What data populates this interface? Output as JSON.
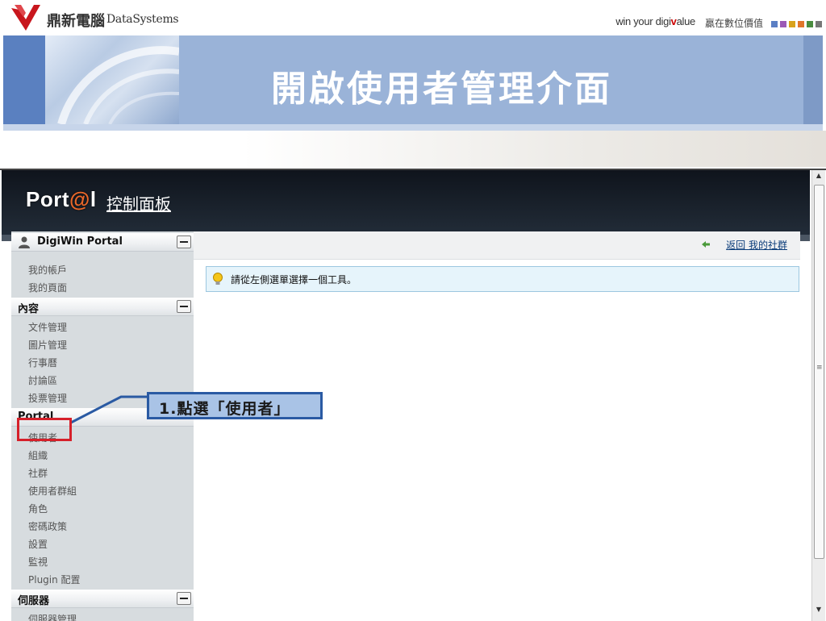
{
  "slide": {
    "company_cn": "鼎新電腦",
    "company_en": "DataSystems",
    "slogan_prefix": "win your digi",
    "slogan_mark": "v",
    "slogan_suffix": "alue",
    "slogan_cn": "贏在數位價值",
    "title": "開啟使用者管理介面",
    "slogan_squares": [
      "#5b7fc4",
      "#9b59b6",
      "#d9a21b",
      "#e0752a",
      "#4a8c3f",
      "#777777"
    ]
  },
  "portal": {
    "logo_prefix": "Port",
    "logo_at": "@",
    "logo_suffix": "l",
    "title": "控制面板"
  },
  "sidebar": {
    "sections": [
      {
        "label": "DigiWin Portal",
        "items": [
          "我的帳戶",
          "我的頁面"
        ]
      },
      {
        "label": "內容",
        "items": [
          "文件管理",
          "圖片管理",
          "行事曆",
          "討論區",
          "投票管理"
        ]
      },
      {
        "label": "Portal",
        "items": [
          "使用者",
          "組織",
          "社群",
          "使用者群組",
          "角色",
          "密碼政策",
          "設置",
          "監視",
          "Plugin 配置"
        ]
      },
      {
        "label": "伺服器",
        "items": [
          "伺服器管理"
        ]
      }
    ]
  },
  "main": {
    "back_link": "返回 我的社群",
    "info_message": "請從左側選單選擇一個工具。"
  },
  "annotation": {
    "callout": "1.點選「使用者」"
  },
  "colors": {
    "banner_blue": "#9ab3d8",
    "header_dark": "#1a212b",
    "sidebar_bg": "#d7dcdf",
    "highlight_red": "#d6202a",
    "callout_border": "#2a5aa3"
  }
}
